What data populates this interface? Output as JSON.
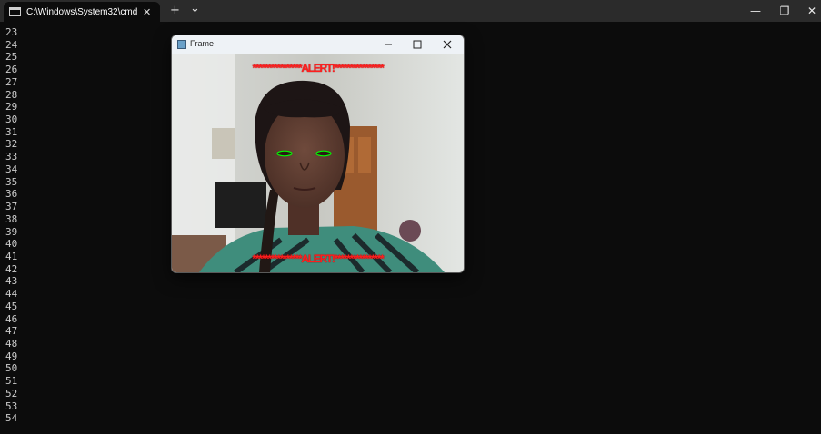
{
  "terminal": {
    "tab_title": "C:\\Windows\\System32\\cmd.e",
    "tab_close": "✕",
    "new_tab": "+",
    "dropdown": "⌄",
    "minimize": "—",
    "restore": "❐",
    "close": "✕",
    "line_numbers": [
      "23",
      "24",
      "25",
      "26",
      "27",
      "28",
      "29",
      "30",
      "31",
      "32",
      "33",
      "34",
      "35",
      "36",
      "37",
      "38",
      "39",
      "40",
      "41",
      "42",
      "43",
      "44",
      "45",
      "46",
      "47",
      "48",
      "49",
      "50",
      "51",
      "52",
      "53",
      "54"
    ]
  },
  "frame_window": {
    "title": "Frame",
    "alert_top": "****************ALERT!****************",
    "alert_bottom": "****************ALERT!****************"
  },
  "colors": {
    "terminal_bg": "#0c0c0c",
    "alert_red": "#ff1e1e",
    "eye_contour": "#00ff00"
  }
}
